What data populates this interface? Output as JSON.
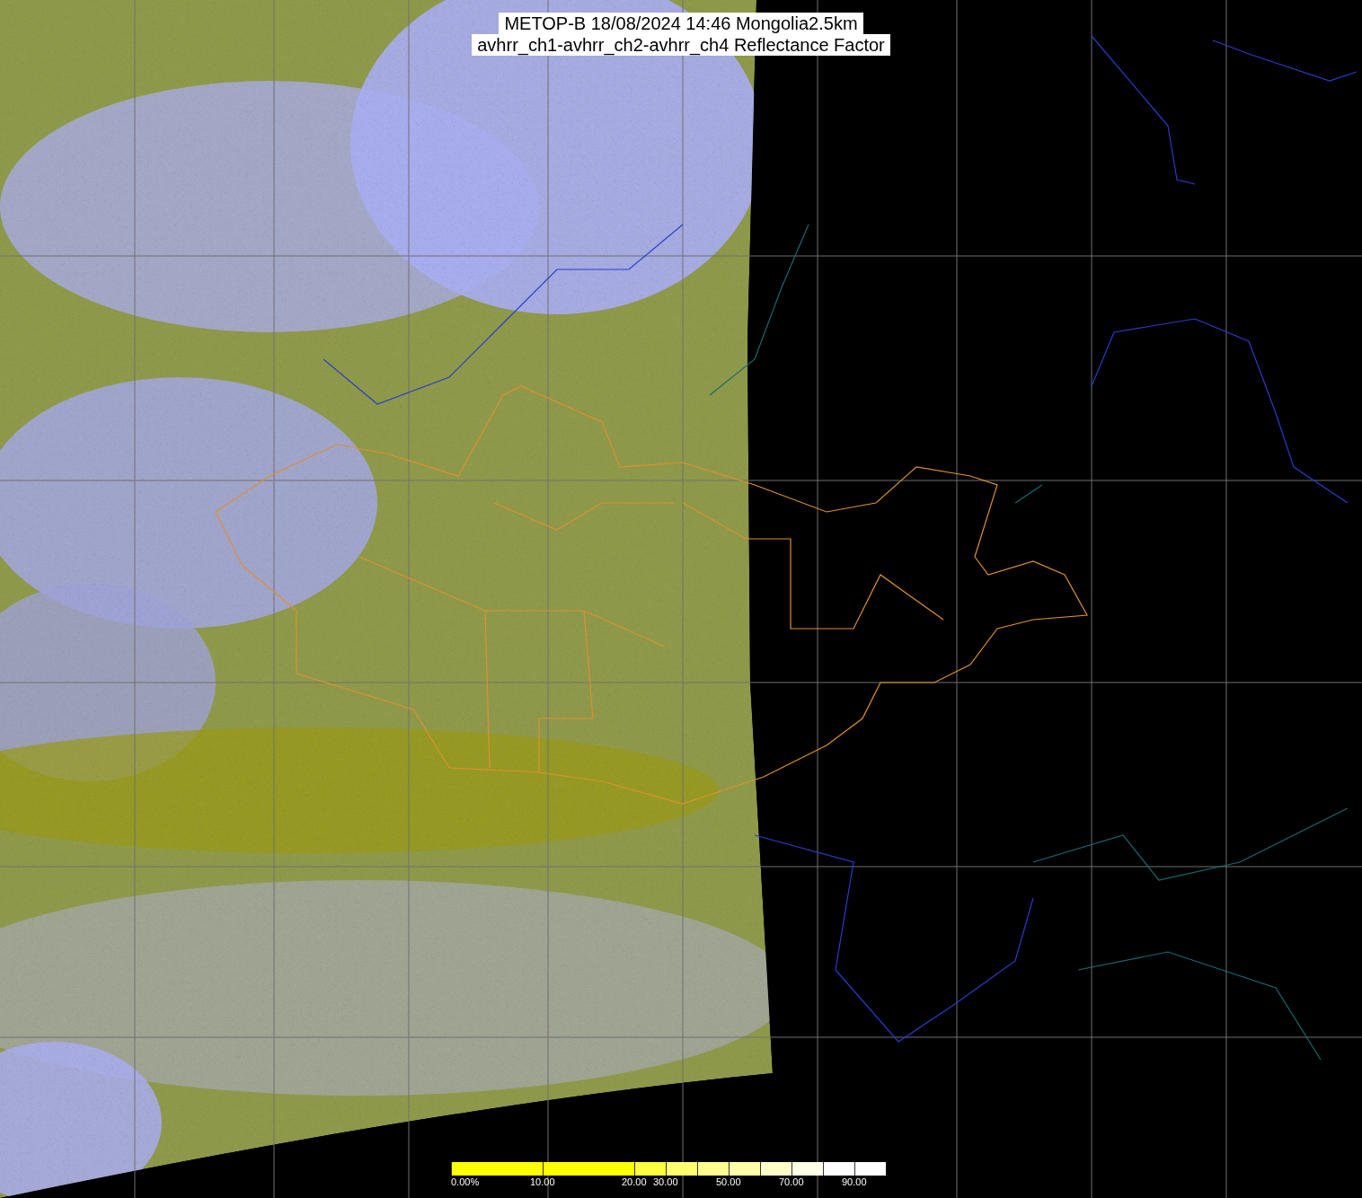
{
  "title": {
    "lines": [
      "METOP-B 18/08/2024 14:46 Mongolia2.5km",
      "avhrr_ch1-avhrr_ch2-avhrr_ch4 Reflectance Factor"
    ]
  },
  "colorbar": {
    "segments": [
      {
        "color": "#ffff00",
        "label": "0.00%"
      },
      {
        "color": "#ffff00",
        "label": "10.00"
      },
      {
        "color": "#ffff40",
        "label": "20.00"
      },
      {
        "color": "#ffff70",
        "label": "30.00"
      },
      {
        "color": "#ffff90"
      },
      {
        "color": "#ffffa8",
        "label": "50.00"
      },
      {
        "color": "#ffffc8"
      },
      {
        "color": "#ffffe6",
        "label": "70.00"
      },
      {
        "color": "#ffffff"
      },
      {
        "color": "#ffffff",
        "label": "90.00"
      }
    ]
  }
}
